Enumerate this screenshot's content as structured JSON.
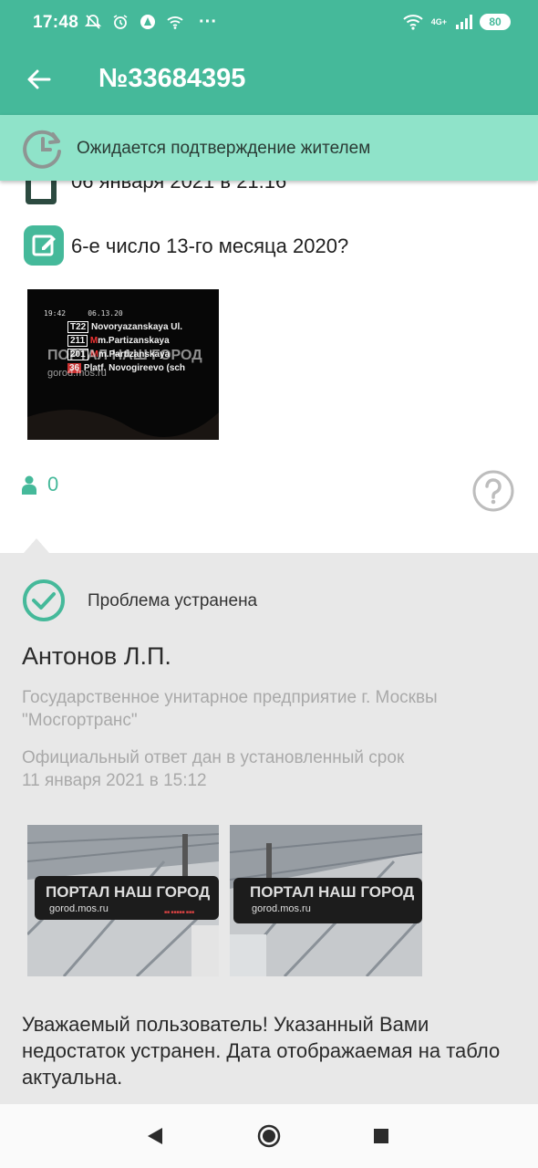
{
  "status_bar": {
    "time": "17:48",
    "network": "4G+",
    "battery": "80"
  },
  "app_bar": {
    "title": "№33684395"
  },
  "banner": {
    "text": "Ожидается подтверждение жителем"
  },
  "issue": {
    "date": "06 января 2021 в 21:16",
    "description": "6-е число 13-го месяца 2020?",
    "photo_lines": [
      {
        "route": "19:42",
        "dest": "06.13.20"
      },
      {
        "route": "T22",
        "dest": "Novoryazanskaya Ul."
      },
      {
        "route": "211",
        "dest": "m.Partizanskaya"
      },
      {
        "route": "201",
        "dest": "m.Partizanskaya"
      },
      {
        "route": "36",
        "dest": "Platf. Novogireevo (sch"
      }
    ],
    "votes": "0"
  },
  "watermark": {
    "title": "ПОРТАЛ НАШ ГОРОД",
    "url": "gorod.mos.ru"
  },
  "response": {
    "status": "Проблема устранена",
    "person": "Антонов Л.П.",
    "organization": "Государственное унитарное предприятие г. Москвы \"Мосгортранс\"",
    "official_label": "Официальный ответ дан в установленный срок",
    "official_date": "11 января 2021 в 15:12",
    "message": "Уважаемый пользователь! Указанный Вами недостаток устранен. Дата отображаемая на табло актуальна."
  },
  "colors": {
    "primary": "#45b99a",
    "banner": "#8fe3c9",
    "response_bg": "#e8e8e8",
    "muted_text": "#a9a9a9"
  },
  "icons": [
    "back-arrow-icon",
    "clock-refresh-icon",
    "calendar-icon",
    "edit-icon",
    "person-icon",
    "help-icon",
    "check-circle-icon",
    "nav-back-icon",
    "nav-home-icon",
    "nav-recents-icon"
  ]
}
